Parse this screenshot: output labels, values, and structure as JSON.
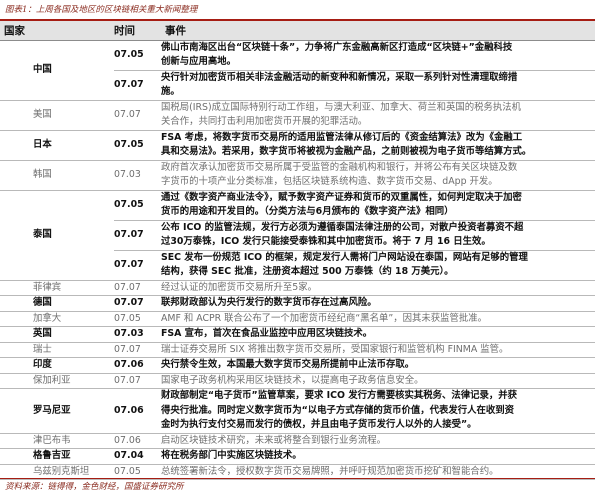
{
  "caption": "图表1：上周各国及地区的区块链相关重大新闻整理",
  "headers": {
    "country": "国家",
    "time": "时间",
    "event": "事件"
  },
  "rows": [
    {
      "country": "中国",
      "style": "bold",
      "entries": [
        {
          "time": "07.05",
          "lines": [
            "佛山市南海区出台“区块链十条”，力争将广东金融高新区打造成“区块链+”金融科技",
            "创新与应用高地。"
          ]
        },
        {
          "time": "07.07",
          "lines": [
            "央行针对加密货币相关非法金融活动的新变种和新情况，采取一系列针对性清理取缔措",
            "施。"
          ]
        }
      ]
    },
    {
      "country": "美国",
      "style": "light",
      "entries": [
        {
          "time": "07.07",
          "lines": [
            "国税局(IRS)成立国际特别行动工作组，与澳大利亚、加拿大、荷兰和英国的税务执法机",
            "关合作，共同打击利用加密货币开展的犯罪活动。"
          ]
        }
      ]
    },
    {
      "country": "日本",
      "style": "bold",
      "entries": [
        {
          "time": "07.05",
          "lines": [
            "FSA 考虑，将数字货币交易所的适用监管法律从修订后的《资金结算法》改为《金融工",
            "具和交易法》。若采用，数字货币将被视为金融产品，之前则被视为电子货币等结算方式。"
          ]
        }
      ]
    },
    {
      "country": "韩国",
      "style": "light",
      "entries": [
        {
          "time": "07.03",
          "lines": [
            "政府首次承认加密货币交易所属于受监管的金融机构和银行，并将公布有关区块链及数",
            "字货币的十项产业分类标准，包括区块链系统构造、数字货币交易、dApp 开发。"
          ]
        }
      ]
    },
    {
      "country": "泰国",
      "style": "bold",
      "entries": [
        {
          "time": "07.05",
          "lines": [
            "通过《数字资产商业法令》，赋予数字资产证券和货币的双重属性，如何判定取决于加密",
            "货币的用途和开发目的。（分类方法与6月颁布的《数字资产法》相同）"
          ]
        },
        {
          "time": "07.07",
          "lines": [
            "公布 ICO 的监管法规，发行方必须为遵循泰国法律注册的公司，对散户投资者募资不超",
            "过30万泰铢，ICO 发行只能接受泰铢和其中加密货币。将于 7 月 16 日生效。"
          ]
        },
        {
          "time": "07.07",
          "lines": [
            "SEC 发布一份规范 ICO 的框架，规定发行人需将门户网站设在泰国，网站有足够的管理",
            "结构，获得 SEC 批准，注册资本超过 500 万泰铢（约 18 万美元）。"
          ]
        }
      ]
    },
    {
      "country": "菲律宾",
      "style": "light",
      "entries": [
        {
          "time": "07.07",
          "lines": [
            "经过认证的加密货币交易所升至5家。"
          ]
        }
      ]
    },
    {
      "country": "德国",
      "style": "bold",
      "entries": [
        {
          "time": "07.07",
          "lines": [
            "联邦财政部认为央行发行的数字货币存在过高风险。"
          ]
        }
      ]
    },
    {
      "country": "加拿大",
      "style": "light",
      "entries": [
        {
          "time": "07.05",
          "lines": [
            "AMF 和 ACPR 联合公布了一个加密货币经纪商“黑名单”，因其未获监管批准。"
          ]
        }
      ]
    },
    {
      "country": "英国",
      "style": "bold",
      "entries": [
        {
          "time": "07.03",
          "lines": [
            "FSA 宣布，首次在食品业监控中应用区块链技术。"
          ]
        }
      ]
    },
    {
      "country": "瑞士",
      "style": "light",
      "entries": [
        {
          "time": "07.07",
          "lines": [
            "瑞士证券交易所 SIX 将推出数字货币交易所，受国家银行和监管机构 FINMA 监管。"
          ]
        }
      ]
    },
    {
      "country": "印度",
      "style": "bold",
      "entries": [
        {
          "time": "07.06",
          "lines": [
            "央行禁令生效，本国最大数字货币交易所提前中止法币存取。"
          ]
        }
      ]
    },
    {
      "country": "保加利亚",
      "style": "light",
      "entries": [
        {
          "time": "07.07",
          "lines": [
            "国家电子政务机构采用区块链技术，以提高电子政务信息安全。"
          ]
        }
      ]
    },
    {
      "country": "罗马尼亚",
      "style": "bold",
      "entries": [
        {
          "time": "07.06",
          "lines": [
            "财政部制定“电子货币”监管草案，要求 ICO 发行方需要核实其税务、法律记录，并获",
            "得央行批准。同时定义数字货币为“以电子方式存储的货币价值，代表发行人在收到资",
            "金时为执行支付交易而发行的债权，并且由电子货币发行人以外的人接受”。"
          ]
        }
      ]
    },
    {
      "country": "津巴布韦",
      "style": "light",
      "entries": [
        {
          "time": "07.06",
          "lines": [
            "启动区块链技术研究，未来或将整合到银行业务流程。"
          ]
        }
      ]
    },
    {
      "country": "格鲁吉亚",
      "style": "bold",
      "entries": [
        {
          "time": "07.04",
          "lines": [
            "将在税务部门中实施区块链技术。"
          ]
        }
      ]
    },
    {
      "country": "乌兹别克斯坦",
      "style": "light",
      "entries": [
        {
          "time": "07.05",
          "lines": [
            "总统签署新法令，授权数字货币交易牌照，并呼吁规范加密货币挖矿和智能合约。"
          ]
        }
      ]
    }
  ],
  "footer": "资料来源：链得得，金色财经，国盛证券研究所"
}
